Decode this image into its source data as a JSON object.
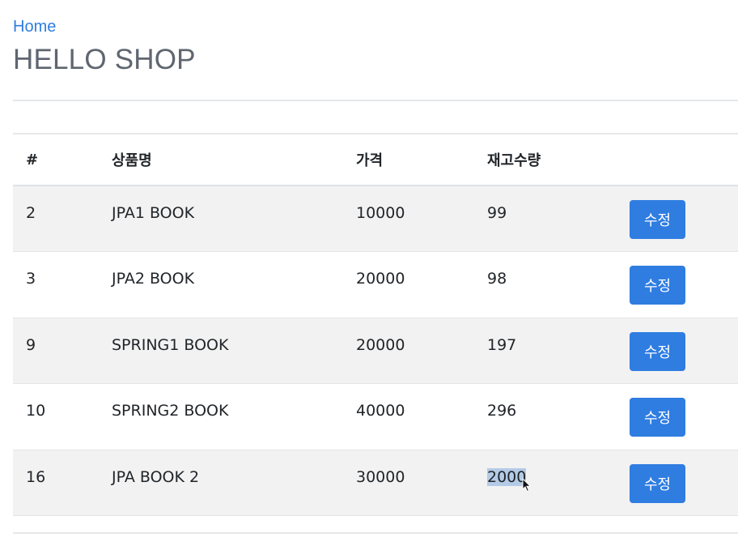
{
  "nav": {
    "home_label": "Home"
  },
  "header": {
    "title": "HELLO SHOP"
  },
  "table": {
    "headers": {
      "id": "#",
      "name": "상품명",
      "price": "가격",
      "stock": "재고수량"
    },
    "rows": [
      {
        "id": "2",
        "name": "JPA1 BOOK",
        "price": "10000",
        "stock": "99",
        "action": "수정"
      },
      {
        "id": "3",
        "name": "JPA2 BOOK",
        "price": "20000",
        "stock": "98",
        "action": "수정"
      },
      {
        "id": "9",
        "name": "SPRING1 BOOK",
        "price": "20000",
        "stock": "197",
        "action": "수정"
      },
      {
        "id": "10",
        "name": "SPRING2 BOOK",
        "price": "40000",
        "stock": "296",
        "action": "수정"
      },
      {
        "id": "16",
        "name": "JPA BOOK 2",
        "price": "30000",
        "stock": "2000",
        "action": "수정"
      }
    ]
  },
  "colors": {
    "accent": "#2f7de1",
    "title": "#5f6670",
    "stripe": "#f2f2f2",
    "selection": "#b4cbe7"
  },
  "icons": {
    "cursor": "mouse-pointer-icon"
  }
}
